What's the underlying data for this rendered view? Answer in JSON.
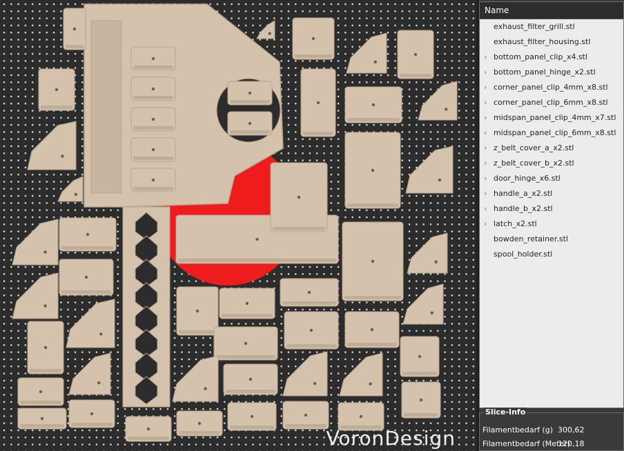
{
  "brand": {
    "text": "VoronDesign"
  },
  "object_list": {
    "header": "Name",
    "items": [
      {
        "label": "exhaust_filter_grill.stl",
        "expandable": false
      },
      {
        "label": "exhaust_filter_housing.stl",
        "expandable": false
      },
      {
        "label": "bottom_panel_clip_x4.stl",
        "expandable": true
      },
      {
        "label": "bottom_panel_hinge_x2.stl",
        "expandable": true
      },
      {
        "label": "corner_panel_clip_4mm_x8.stl",
        "expandable": true
      },
      {
        "label": "corner_panel_clip_6mm_x8.stl",
        "expandable": true
      },
      {
        "label": "midspan_panel_clip_4mm_x7.stl",
        "expandable": true
      },
      {
        "label": "midspan_panel_clip_6mm_x8.stl",
        "expandable": true
      },
      {
        "label": "z_belt_cover_a_x2.stl",
        "expandable": true
      },
      {
        "label": "z_belt_cover_b_x2.stl",
        "expandable": true
      },
      {
        "label": "door_hinge_x6.stl",
        "expandable": true
      },
      {
        "label": "handle_a_x2.stl",
        "expandable": true
      },
      {
        "label": "handle_b_x2.stl",
        "expandable": true
      },
      {
        "label": "latch_x2.stl",
        "expandable": true
      },
      {
        "label": "bowden_retainer.stl",
        "expandable": false
      },
      {
        "label": "spool_holder.stl",
        "expandable": false
      }
    ]
  },
  "slice_info": {
    "title": "Slice-Info",
    "rows": [
      {
        "label": "Filamentbedarf (g)",
        "value": "300,62"
      },
      {
        "label": "Filamentbedarf (Meter)",
        "value": "120,18"
      }
    ]
  },
  "colors": {
    "bed": "#2c2c2c",
    "dot": "#e8e8e8",
    "part": "#d5c2ac",
    "part_shadow": "#b7a48f",
    "logo_red": "#ee1c1c"
  }
}
